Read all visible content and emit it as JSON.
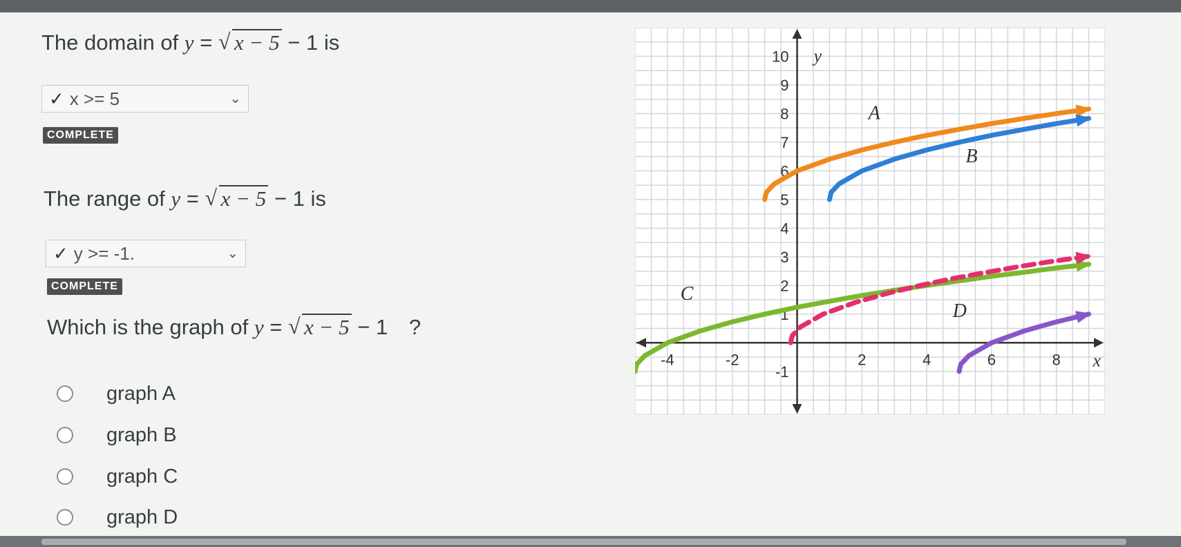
{
  "q1": {
    "prefix": "The domain of",
    "y": "y",
    "eq": "=",
    "radicand": "x − 5",
    "tail": "− 1",
    "suffix": "is",
    "answer": "x >= 5",
    "check": "✓",
    "chevron": "⌄",
    "status": "COMPLETE"
  },
  "q2": {
    "prefix": "The range of",
    "y": "y",
    "eq": "=",
    "radicand": "x − 5",
    "tail": "− 1",
    "suffix": "is",
    "answer": "y >= -1.",
    "check": "✓",
    "chevron": "⌄",
    "status": "COMPLETE"
  },
  "q3": {
    "prefix": "Which is the graph of",
    "y": "y",
    "eq": "=",
    "radicand": "x − 5",
    "tail": "− 1",
    "suffix": "?"
  },
  "options": [
    {
      "label": "graph A"
    },
    {
      "label": "graph B"
    },
    {
      "label": "graph C"
    },
    {
      "label": "graph D"
    }
  ],
  "chart_data": {
    "type": "line",
    "xlim": [
      -5,
      9.5
    ],
    "ylim": [
      -2.5,
      11
    ],
    "grid": true,
    "x_axis_label": "x",
    "y_axis_label": "y",
    "x_ticks": [
      "-4",
      "-2",
      "2",
      "4",
      "6",
      "8"
    ],
    "x_tick_values": [
      -4,
      -2,
      2,
      4,
      6,
      8
    ],
    "y_ticks": [
      "-1",
      "1",
      "2",
      "3",
      "4",
      "5",
      "6",
      "7",
      "8",
      "9",
      "10"
    ],
    "y_tick_values": [
      -1,
      1,
      2,
      3,
      4,
      5,
      6,
      7,
      8,
      9,
      10
    ],
    "series": [
      {
        "name": "A",
        "color": "#f0891e",
        "dashed": false,
        "label_at": [
          2.2,
          7.8
        ],
        "x": [
          -1,
          -0.95,
          -0.7,
          0,
          1,
          2,
          3,
          4,
          5,
          6,
          7,
          8,
          9
        ],
        "y": [
          5,
          5.25,
          5.55,
          6,
          6.41,
          6.73,
          7,
          7.24,
          7.45,
          7.65,
          7.83,
          8,
          8.16
        ]
      },
      {
        "name": "B",
        "color": "#2f7fd6",
        "dashed": false,
        "label_at": [
          5.2,
          6.3
        ],
        "x": [
          1,
          1.05,
          1.3,
          2,
          3,
          4,
          5,
          6,
          7,
          8,
          9
        ],
        "y": [
          5,
          5.25,
          5.55,
          6,
          6.41,
          6.73,
          7,
          7.24,
          7.45,
          7.65,
          7.83
        ]
      },
      {
        "name": "C",
        "color": "#7cb82f",
        "dashed": false,
        "label_at": [
          -3.6,
          1.5
        ],
        "x": [
          -5,
          -4.95,
          -4.7,
          -4,
          -3,
          -2,
          -1,
          0,
          1,
          2,
          3,
          4,
          5,
          6,
          7,
          8,
          9
        ],
        "y": [
          -1,
          -0.75,
          -0.45,
          0,
          0.41,
          0.73,
          1,
          1.24,
          1.45,
          1.65,
          1.83,
          2,
          2.16,
          2.32,
          2.46,
          2.61,
          2.74
        ]
      },
      {
        "name": "",
        "color": "#e2306c",
        "dashed": true,
        "label_at": null,
        "x": [
          -0.2,
          -0.15,
          0.1,
          0.8,
          1.8,
          2.8,
          3.8,
          4.8,
          5.8,
          6.8,
          7.8,
          9
        ],
        "y": [
          0,
          0.25,
          0.55,
          1,
          1.41,
          1.73,
          2,
          2.24,
          2.45,
          2.65,
          2.83,
          3.02
        ]
      },
      {
        "name": "D",
        "color": "#8a55c9",
        "dashed": false,
        "label_at": [
          4.8,
          0.9
        ],
        "x": [
          5,
          5.05,
          5.3,
          6,
          7,
          8,
          9
        ],
        "y": [
          -1,
          -0.75,
          -0.45,
          0,
          0.41,
          0.73,
          1
        ]
      }
    ]
  }
}
